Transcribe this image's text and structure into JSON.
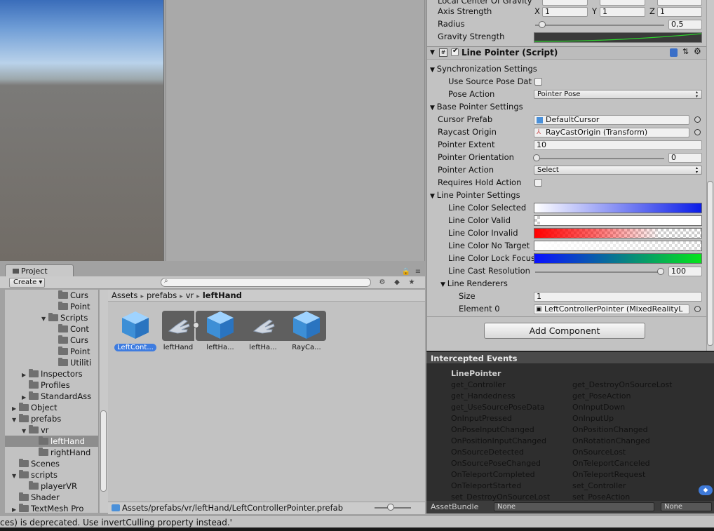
{
  "inspector_top": {
    "local_center_label": "Local Center Of Gravity",
    "axis_strength_label": "Axis Strength",
    "axis_x_label": "X",
    "axis_x": "1",
    "axis_y_label": "Y",
    "axis_y": "1",
    "axis_z_label": "Z",
    "axis_z": "1",
    "radius_label": "Radius",
    "radius": "0,5",
    "gravity_label": "Gravity Strength"
  },
  "component": {
    "title": "Line Pointer (Script)",
    "sync_section": "Synchronization Settings",
    "use_source_label": "Use Source Pose Dat",
    "pose_action_label": "Pose Action",
    "pose_action_value": "Pointer Pose",
    "base_section": "Base Pointer Settings",
    "cursor_prefab_label": "Cursor Prefab",
    "cursor_prefab_value": "DefaultCursor",
    "raycast_origin_label": "Raycast Origin",
    "raycast_origin_value": "RayCastOrigin (Transform)",
    "pointer_extent_label": "Pointer Extent",
    "pointer_extent_value": "10",
    "pointer_orientation_label": "Pointer Orientation",
    "pointer_orientation_value": "0",
    "pointer_action_label": "Pointer Action",
    "pointer_action_value": "Select",
    "requires_hold_label": "Requires Hold Action",
    "line_section": "Line Pointer Settings",
    "color_selected_label": "Line Color Selected",
    "color_valid_label": "Line Color Valid",
    "color_invalid_label": "Line Color Invalid",
    "color_no_target_label": "Line Color No Target",
    "color_lock_label": "Line Color Lock Focus",
    "cast_resolution_label": "Line Cast Resolution",
    "cast_resolution_value": "100",
    "renderers_label": "Line Renderers",
    "size_label": "Size",
    "size_value": "1",
    "element0_label": "Element 0",
    "element0_value": "LeftControllerPointer (MixedRealityL"
  },
  "add_component_label": "Add Component",
  "events": {
    "header": "Intercepted Events",
    "title": "LinePointer",
    "left": [
      "get_Controller",
      "get_Handedness",
      "get_UseSourcePoseData",
      "OnInputPressed",
      "OnPoseInputChanged",
      "OnPositionInputChanged",
      "OnSourceDetected",
      "OnSourcePoseChanged",
      "OnTeleportCompleted",
      "OnTeleportStarted",
      "set_DestroyOnSourceLost",
      "set_UseSo"
    ],
    "right": [
      "get_DestroyOnSourceLost",
      "get_PoseAction",
      "OnInputDown",
      "OnInputUp",
      "OnPositionChanged",
      "OnRotationChanged",
      "OnSourceLost",
      "OnTeleportCanceled",
      "OnTeleportRequest",
      "set_Controller",
      "set_PoseAction"
    ]
  },
  "asset_bundle": {
    "label": "AssetBundle",
    "value1": "None",
    "value2": "None"
  },
  "project": {
    "tab": "Project",
    "create": "Create",
    "tree": [
      {
        "label": "Curs",
        "depth": 5,
        "arrow": ""
      },
      {
        "label": "Point",
        "depth": 5,
        "arrow": ""
      },
      {
        "label": "Scripts",
        "depth": 4,
        "arrow": "▼"
      },
      {
        "label": "Cont",
        "depth": 5,
        "arrow": ""
      },
      {
        "label": "Curs",
        "depth": 5,
        "arrow": ""
      },
      {
        "label": "Point",
        "depth": 5,
        "arrow": ""
      },
      {
        "label": "Utiliti",
        "depth": 5,
        "arrow": ""
      },
      {
        "label": "Inspectors",
        "depth": 2,
        "arrow": "▶"
      },
      {
        "label": "Profiles",
        "depth": 2,
        "arrow": ""
      },
      {
        "label": "StandardAss",
        "depth": 2,
        "arrow": "▶"
      },
      {
        "label": "Object",
        "depth": 1,
        "arrow": "▶"
      },
      {
        "label": "prefabs",
        "depth": 1,
        "arrow": "▼"
      },
      {
        "label": "vr",
        "depth": 2,
        "arrow": "▼"
      },
      {
        "label": "leftHand",
        "depth": 3,
        "arrow": "",
        "selected": true
      },
      {
        "label": "rightHand",
        "depth": 3,
        "arrow": ""
      },
      {
        "label": "Scenes",
        "depth": 1,
        "arrow": ""
      },
      {
        "label": "scripts",
        "depth": 1,
        "arrow": "▼"
      },
      {
        "label": "playerVR",
        "depth": 2,
        "arrow": ""
      },
      {
        "label": "Shader",
        "depth": 1,
        "arrow": ""
      },
      {
        "label": "TextMesh Pro",
        "depth": 1,
        "arrow": "▶"
      }
    ],
    "breadcrumb": [
      "Assets",
      "prefabs",
      "vr",
      "leftHand"
    ],
    "assets": [
      {
        "label": "LeftCont...",
        "kind": "cube",
        "selected": true
      },
      {
        "label": "leftHand",
        "kind": "hand"
      },
      {
        "label": "leftHa...",
        "kind": "cube"
      },
      {
        "label": "leftHa...",
        "kind": "hand"
      },
      {
        "label": "RayCa...",
        "kind": "cube"
      }
    ],
    "path": "Assets/prefabs/vr/leftHand/LeftControllerPointer.prefab"
  },
  "console_message": "ces) is deprecated. Use invertCulling property instead.'",
  "colors": {
    "selection": "#3e7ce0",
    "events_bg": "#2e2e2e",
    "inspector_bg": "#c2c2c2"
  }
}
